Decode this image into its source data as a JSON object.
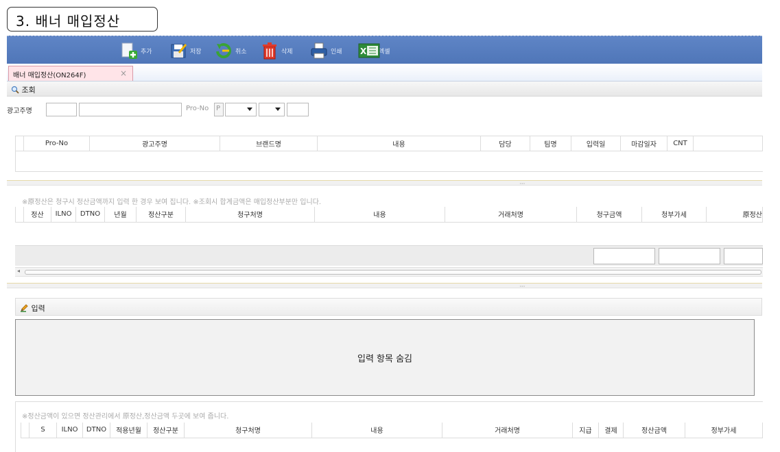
{
  "section_title": "3. 배너 매입정산",
  "toolbar": {
    "add": "추가",
    "save": "저장",
    "cancel": "취소",
    "delete": "삭제",
    "print": "인쇄",
    "excel": "엑셀"
  },
  "tab": {
    "label": "배너 매입정산(ON264F)",
    "close": "×"
  },
  "search_panel": {
    "title": "조회"
  },
  "search_row": {
    "advertiser_label": "광고주명",
    "pro_no_label": "Pro-No",
    "pro_no_prefix": "P"
  },
  "top_grid": {
    "columns": [
      "Pro-No",
      "광고주명",
      "브랜드명",
      "내용",
      "담당",
      "팀명",
      "입력일",
      "마감일자",
      "CNT"
    ]
  },
  "middle": {
    "note": "※原정산은 청구시 정산금액까지 입력 한 경우 보여 집니다.   ※조회시 합계금액은 매입정산부분만 입니다.",
    "columns": [
      "정산",
      "ILNO",
      "DTNO",
      "년월",
      "정산구분",
      "청구처명",
      "내용",
      "거래처명",
      "청구금액",
      "청부가세",
      "原정산"
    ]
  },
  "input_panel": {
    "title": "입력",
    "hidden_text": "입력 항목 숨김"
  },
  "bottom": {
    "note": "※정산금액이 있으면 정산관리에서 原정산,정산금액 두곳에 보여 줍니다.",
    "columns": [
      "S",
      "ILNO",
      "DTNO",
      "적용년월",
      "정산구분",
      "청구처명",
      "내용",
      "거래처명",
      "지급",
      "결제",
      "정산금액",
      "정부가세"
    ]
  }
}
